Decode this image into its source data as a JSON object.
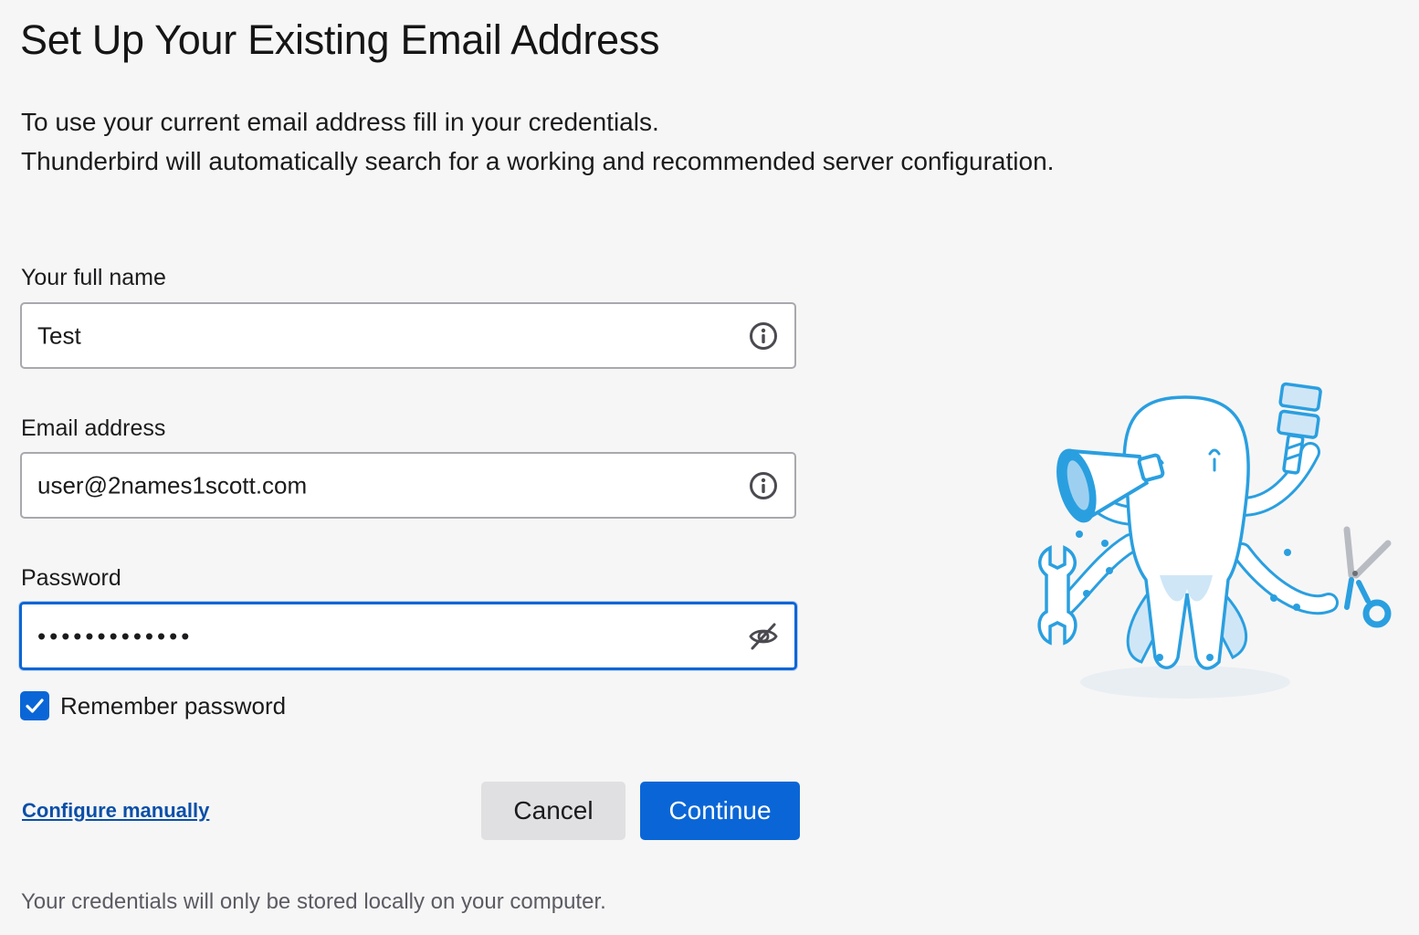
{
  "header": {
    "title": "Set Up Your Existing Email Address"
  },
  "intro": {
    "line1": "To use your current email address fill in your credentials.",
    "line2": "Thunderbird will automatically search for a working and recommended server configuration."
  },
  "form": {
    "full_name": {
      "label": "Your full name",
      "value": "Test",
      "icon": "info-icon"
    },
    "email": {
      "label": "Email address",
      "value": "user@2names1scott.com",
      "icon": "info-icon"
    },
    "password": {
      "label": "Password",
      "masked_value": "•••••••••••••",
      "icon": "eye-slash-icon"
    },
    "remember_password": {
      "label": "Remember password",
      "checked": true
    }
  },
  "actions": {
    "configure_manually": "Configure manually",
    "cancel": "Cancel",
    "continue": "Continue"
  },
  "footer": {
    "note": "Your credentials will only be stored locally on your computer."
  },
  "colors": {
    "accent": "#0a66d6",
    "link": "#0b4fa8",
    "background": "#f6f6f6",
    "illustration": "#2a9fe0"
  },
  "illustration": {
    "icon": "octopus-mascot-illustration"
  }
}
